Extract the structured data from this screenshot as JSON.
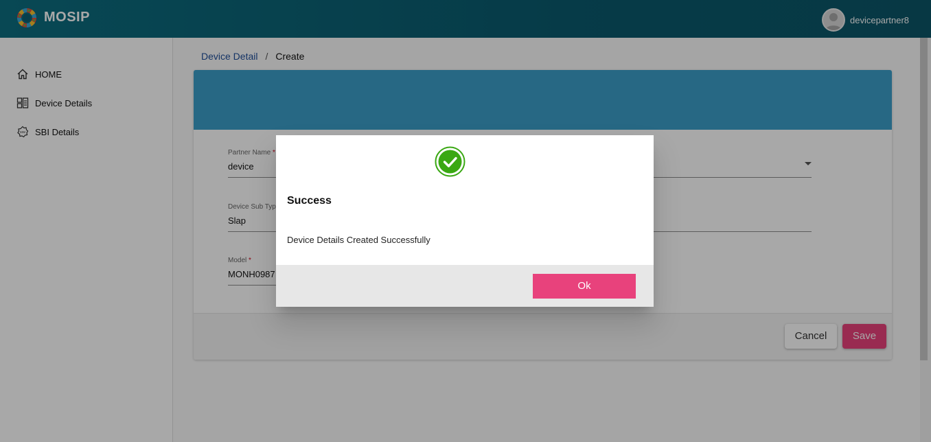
{
  "app": {
    "brand": "MOSIP",
    "username": "devicepartner8"
  },
  "sidebar": {
    "items": [
      {
        "label": "HOME",
        "icon": "home-icon"
      },
      {
        "label": "Device Details",
        "icon": "device-details-icon"
      },
      {
        "label": "SBI Details",
        "icon": "sbi-gear-icon"
      }
    ]
  },
  "breadcrumb": {
    "parent": "Device Detail",
    "separator": "/",
    "current": "Create"
  },
  "form": {
    "partner_name": {
      "label": "Partner Name",
      "required_mark": "*",
      "value": "device"
    },
    "device_sub_type": {
      "label": "Device Sub Type",
      "value": "Slap"
    },
    "model": {
      "label": "Model",
      "required_mark": "*",
      "value": "MONH0987"
    },
    "cancel_label": "Cancel",
    "save_label": "Save"
  },
  "dialog": {
    "icon": "success-check-icon",
    "title": "Success",
    "message": "Device Details Created Successfully",
    "ok_label": "Ok"
  },
  "colors": {
    "header": "#0b5f73",
    "card_header": "#3c9ec8",
    "accent": "#e8427c",
    "success": "#3aa813"
  }
}
